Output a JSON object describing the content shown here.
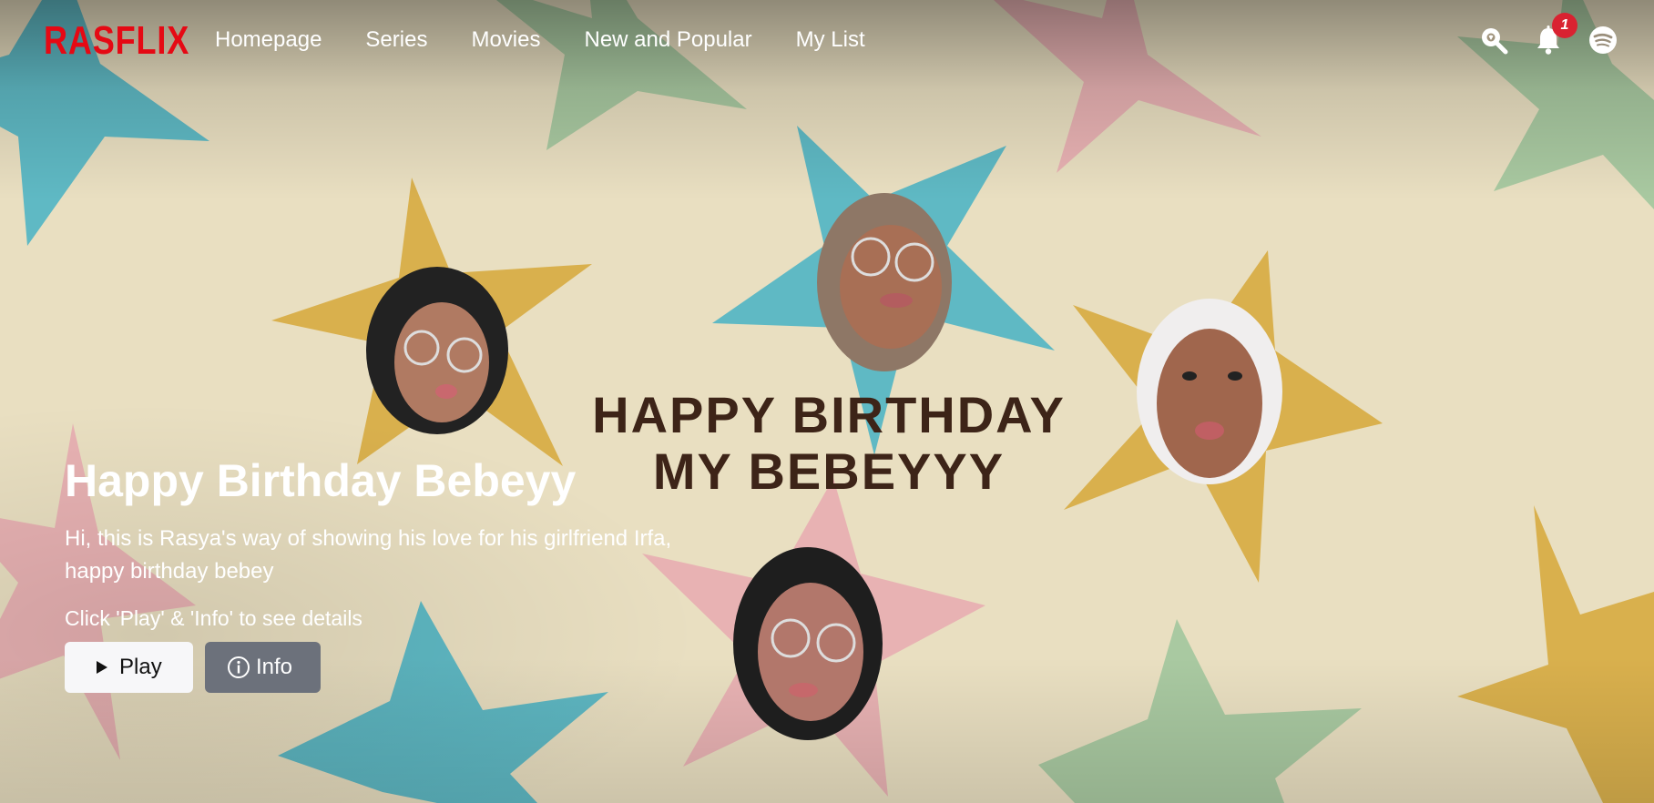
{
  "app": {
    "logo_text": "RASFLIX",
    "brand_color": "#e50914"
  },
  "nav": {
    "items": [
      {
        "label": "Homepage"
      },
      {
        "label": "Series"
      },
      {
        "label": "Movies"
      },
      {
        "label": "New and Popular"
      },
      {
        "label": "My List"
      }
    ]
  },
  "header_icons": {
    "search_icon": "search-icon",
    "bell_icon": "bell-icon",
    "notification_count": "1",
    "profile_icon": "spotify-icon"
  },
  "banner": {
    "line1": "HAPPY BIRTHDAY",
    "line2": "MY BEBEYYY",
    "background_color": "#e9dfc1",
    "star_colors": [
      "#d9b04d",
      "#5fb9c4",
      "#e8b2b3",
      "#a9c9a1"
    ]
  },
  "hero": {
    "title": "Happy Birthday Bebeyy",
    "description": "Hi, this is Rasya's way of showing his love for his girlfriend Irfa, happy birthday bebey",
    "hint": "Click 'Play' & 'Info' to see details",
    "play_label": "Play",
    "info_label": "Info"
  }
}
